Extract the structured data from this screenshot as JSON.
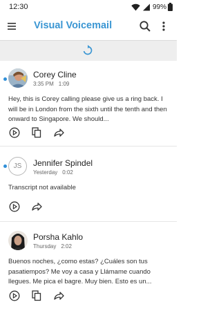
{
  "status_bar": {
    "time": "12:30",
    "battery": "99%"
  },
  "app_bar": {
    "title": "Visual Voicemail",
    "icons": [
      "menu-icon",
      "search-icon",
      "more-vert-icon"
    ]
  },
  "refresh": {
    "icon": "refresh-icon"
  },
  "colors": {
    "accent": "#3a96d3",
    "unread_dot": "#2f8fd8",
    "strip_bg": "#eeeeee"
  },
  "voicemails": [
    {
      "name": "Corey Cline",
      "date": "3:35 PM",
      "duration": "1:09",
      "unread": true,
      "avatar": "photo",
      "transcript": "Hey, this is Corey calling please give us a ring back. I will be in London from the sixth until the tenth and then onward to Singapore. We should...",
      "actions": [
        "play-icon",
        "copy-icon",
        "share-icon"
      ]
    },
    {
      "name": "Jennifer Spindel",
      "date": "Yesterday",
      "duration": "0:02",
      "unread": true,
      "avatar_initials": "JS",
      "transcript": "Transcript not available",
      "actions": [
        "play-icon",
        "share-icon"
      ]
    },
    {
      "name": "Porsha Kahlo",
      "date": "Thursday",
      "duration": "2:02",
      "unread": false,
      "avatar": "photo",
      "transcript": "Buenos noches, ¿como estas? ¿Cuáles son tus pasatiempos? Me voy a casa y Llámame cuando llegues. Me pica el bagre. Muy bien. Esto es un...",
      "actions": [
        "play-icon",
        "copy-icon",
        "share-icon"
      ]
    }
  ]
}
